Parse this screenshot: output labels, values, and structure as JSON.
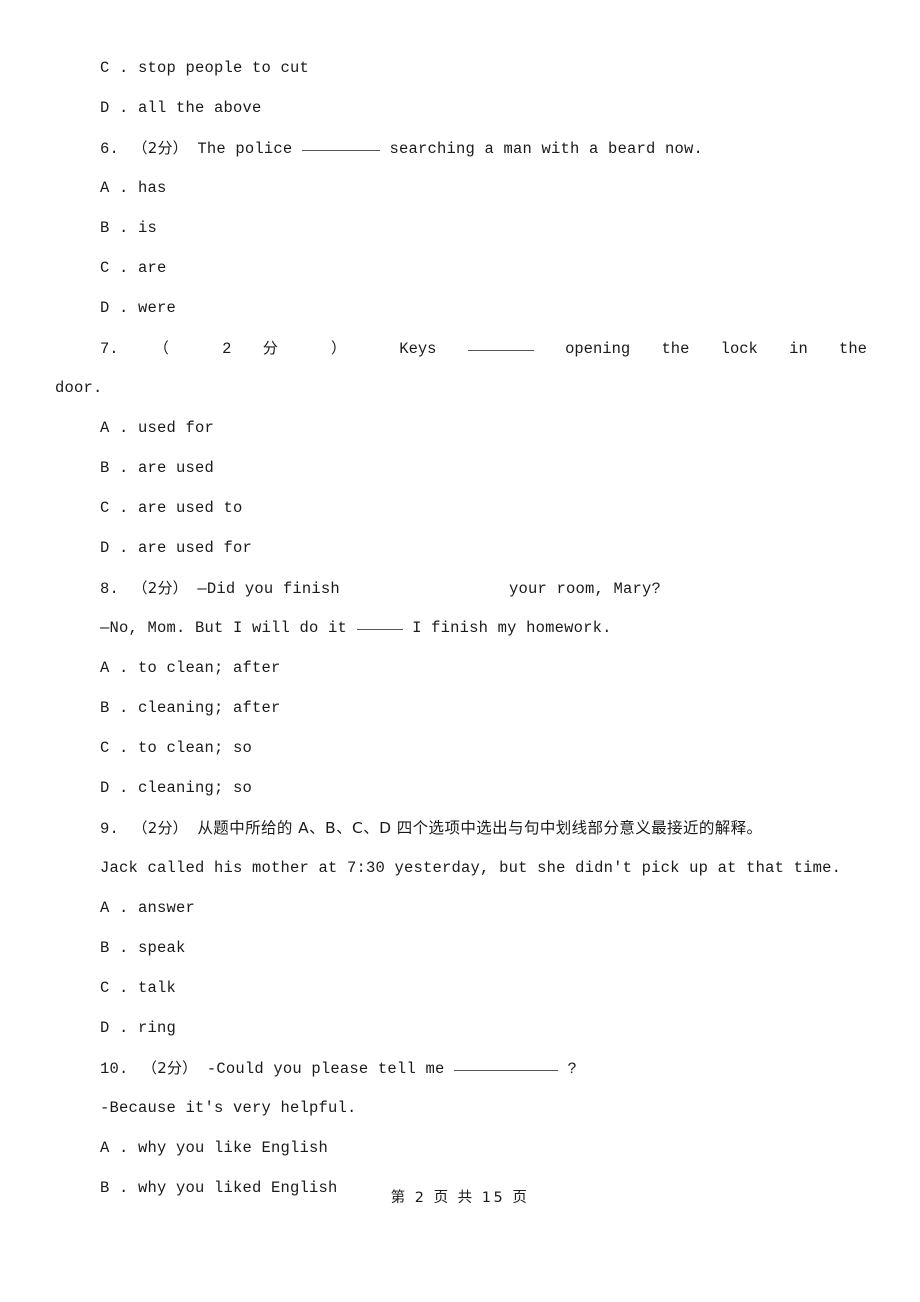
{
  "document": {
    "page_label": "第 2 页 共 15 页",
    "page_number": "2",
    "total_pages": "15"
  },
  "leading_options": [
    {
      "letter": "C .",
      "text": "stop people to cut"
    },
    {
      "letter": "D .",
      "text": "all the above"
    }
  ],
  "questions": [
    {
      "number": "6.",
      "marks": "（2分）",
      "stem_before": "The police",
      "stem_after": "searching a man with a beard now.",
      "options": [
        {
          "letter": "A .",
          "text": "has"
        },
        {
          "letter": "B .",
          "text": "is"
        },
        {
          "letter": "C .",
          "text": "are"
        },
        {
          "letter": "D .",
          "text": "were"
        }
      ]
    },
    {
      "number": "7.",
      "marks_open": "（",
      "marks_value": "2",
      "marks_unit": "分",
      "marks_close": "）",
      "stem_words": [
        "Keys",
        "opening",
        "the",
        "lock",
        "in",
        "the"
      ],
      "stem_continuation": "door.",
      "options": [
        {
          "letter": "A .",
          "text": "used for"
        },
        {
          "letter": "B .",
          "text": "are used"
        },
        {
          "letter": "C .",
          "text": "are used to"
        },
        {
          "letter": "D .",
          "text": "are used for"
        }
      ]
    },
    {
      "number": "8.",
      "marks": "（2分）",
      "stem_before": "—Did you finish",
      "stem_after": "your room, Mary?",
      "stem_line2_before": "—No, Mom. But I will do it",
      "stem_line2_after": "I finish my homework.",
      "options": [
        {
          "letter": "A .",
          "text": "to clean; after"
        },
        {
          "letter": "B .",
          "text": "cleaning; after"
        },
        {
          "letter": "C .",
          "text": "to clean; so"
        },
        {
          "letter": "D .",
          "text": "cleaning; so"
        }
      ]
    },
    {
      "number": "9.",
      "marks": "（2分）",
      "instruction": "从题中所给的 A、B、C、D 四个选项中选出与句中划线部分意义最接近的解释。",
      "sentence": "Jack called his mother at 7:30 yesterday, but she didn't pick up at that time.",
      "options": [
        {
          "letter": "A .",
          "text": "answer"
        },
        {
          "letter": "B .",
          "text": "speak"
        },
        {
          "letter": "C .",
          "text": "talk"
        },
        {
          "letter": "D .",
          "text": "ring"
        }
      ]
    },
    {
      "number": "10.",
      "marks": "（2分）",
      "stem_before": "-Could you please tell me",
      "stem_after": "?",
      "stem_line2": "-Because it's very helpful.",
      "options": [
        {
          "letter": "A .",
          "text": "why you like English"
        },
        {
          "letter": "B .",
          "text": "why you liked English"
        }
      ]
    }
  ]
}
